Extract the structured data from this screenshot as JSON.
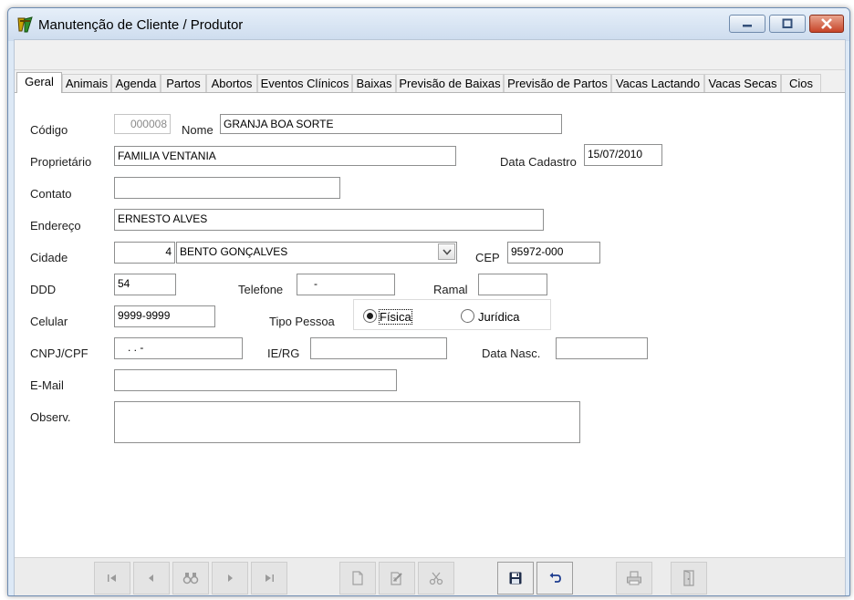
{
  "window": {
    "title": "Manutenção de Cliente / Produtor",
    "colors": {
      "title_bg": "#dde9f6",
      "close_button": "#c74428"
    }
  },
  "tabs": [
    {
      "label": "Geral",
      "active": true
    },
    {
      "label": "Animais"
    },
    {
      "label": "Agenda"
    },
    {
      "label": "Partos"
    },
    {
      "label": "Abortos"
    },
    {
      "label": "Eventos Clínicos"
    },
    {
      "label": "Baixas"
    },
    {
      "label": "Previsão de Baixas"
    },
    {
      "label": "Previsão de Partos"
    },
    {
      "label": "Vacas Lactando"
    },
    {
      "label": "Vacas Secas"
    },
    {
      "label": "Cios"
    }
  ],
  "form": {
    "codigo": {
      "label": "Código",
      "value": "000008"
    },
    "nome": {
      "label": "Nome",
      "value": "GRANJA BOA SORTE"
    },
    "proprietario": {
      "label": "Proprietário",
      "value": "FAMILIA VENTANIA"
    },
    "data_cadastro": {
      "label": "Data Cadastro",
      "value": "15/07/2010"
    },
    "contato": {
      "label": "Contato",
      "value": ""
    },
    "endereco": {
      "label": "Endereço",
      "value": "ERNESTO ALVES"
    },
    "cidade": {
      "label": "Cidade",
      "code": "4",
      "name": "BENTO GONÇALVES"
    },
    "cep": {
      "label": "CEP",
      "value": "95972-000"
    },
    "ddd": {
      "label": "DDD",
      "value": "54"
    },
    "telefone": {
      "label": "Telefone",
      "value": "-"
    },
    "ramal": {
      "label": "Ramal",
      "value": ""
    },
    "celular": {
      "label": "Celular",
      "value": "9999-9999"
    },
    "tipo_pessoa": {
      "label": "Tipo Pessoa",
      "options": [
        "Física",
        "Jurídica"
      ],
      "selected": "Física"
    },
    "cnpj_cpf": {
      "label": "CNPJ/CPF",
      "value": ". . -"
    },
    "ie_rg": {
      "label": "IE/RG",
      "value": ""
    },
    "data_nasc": {
      "label": "Data Nasc.",
      "value": ""
    },
    "email": {
      "label": "E-Mail",
      "value": ""
    },
    "observ": {
      "label": "Observ.",
      "value": ""
    }
  },
  "nav_buttons": [
    {
      "icon": "first-record-icon",
      "enabled": false
    },
    {
      "icon": "previous-record-icon",
      "enabled": false
    },
    {
      "icon": "search-binoculars-icon",
      "enabled": false
    },
    {
      "icon": "next-record-icon",
      "enabled": false
    },
    {
      "icon": "last-record-icon",
      "enabled": false
    },
    {
      "icon": "new-document-icon",
      "enabled": false
    },
    {
      "icon": "edit-document-icon",
      "enabled": false
    },
    {
      "icon": "delete-scissors-icon",
      "enabled": false
    },
    {
      "icon": "save-floppy-icon",
      "enabled": true
    },
    {
      "icon": "undo-icon",
      "enabled": true
    },
    {
      "icon": "print-icon",
      "enabled": false
    },
    {
      "icon": "exit-door-icon",
      "enabled": false
    }
  ]
}
